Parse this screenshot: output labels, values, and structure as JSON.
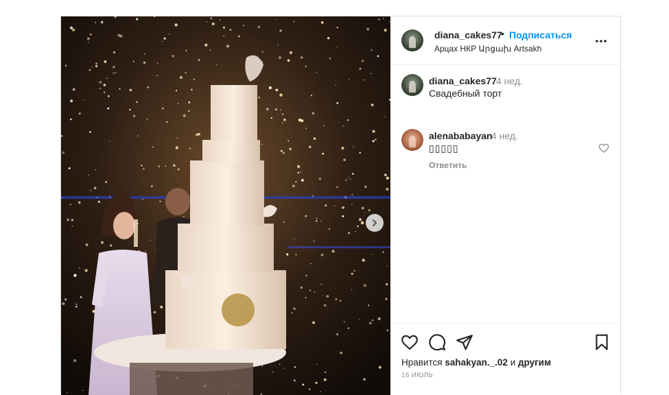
{
  "header": {
    "username": "diana_cakes77",
    "separator": "•",
    "follow_label": "Подписаться",
    "location": "Арцах НКР Արցախ Artsakh",
    "more_label": "•••"
  },
  "caption": {
    "username": "diana_cakes77",
    "time": "4 нед.",
    "text": "Свадебный торт"
  },
  "comments": [
    {
      "username": "alenababayan",
      "time": "4 нед.",
      "text": "▯▯▯▯▯",
      "reply_label": "Ответить"
    }
  ],
  "likes": {
    "prefix": "Нравится",
    "user": "sahakyan._.02",
    "middle": "и",
    "suffix": "другим"
  },
  "date": "16 июль",
  "icons": {
    "more": "more-horizontal-icon",
    "like": "heart-icon",
    "comment": "comment-bubble-icon",
    "share": "paper-plane-icon",
    "save": "bookmark-icon",
    "next": "chevron-right-icon"
  }
}
